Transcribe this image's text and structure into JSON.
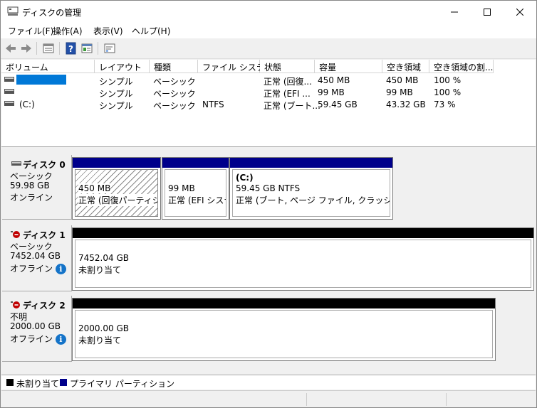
{
  "window": {
    "title": "ディスクの管理",
    "minimize": "—",
    "maximize": "☐",
    "close": "✕"
  },
  "menu": [
    "ファイル(F)",
    "操作(A)",
    "表示(V)",
    "ヘルプ(H)"
  ],
  "toolbar": {
    "icons": [
      "back-arrow-icon",
      "forward-arrow-icon",
      "list-view-icon",
      "help-icon",
      "properties-icon",
      "console-icon"
    ]
  },
  "volume_list": {
    "columns": [
      "ボリューム",
      "レイアウト",
      "種類",
      "ファイル システム",
      "状態",
      "容量",
      "空き領域",
      "空き領域の割..."
    ],
    "rows": [
      {
        "volume": "",
        "layout": "シンプル",
        "type": "ベーシック",
        "fs": "",
        "status": "正常 (回復...",
        "capacity": "450 MB",
        "free": "450 MB",
        "percent": "100 %",
        "selected": true
      },
      {
        "volume": "",
        "layout": "シンプル",
        "type": "ベーシック",
        "fs": "",
        "status": "正常 (EFI ...",
        "capacity": "99 MB",
        "free": "99 MB",
        "percent": "100 %",
        "selected": false
      },
      {
        "volume": "(C:)",
        "layout": "シンプル",
        "type": "ベーシック",
        "fs": "NTFS",
        "status": "正常 (ブート...",
        "capacity": "59.45 GB",
        "free": "43.32 GB",
        "percent": "73 %",
        "selected": false
      }
    ]
  },
  "disks": [
    {
      "name": "ディスク 0",
      "type": "ベーシック",
      "size": "59.98 GB",
      "state": "オンライン",
      "partitions": [
        {
          "title": "",
          "size": "450 MB",
          "status": "正常 (回復パーティション)"
        },
        {
          "title": "",
          "size": "99 MB",
          "status": "正常 (EFI システム パーティション)"
        },
        {
          "title": "(C:)",
          "size": "59.45 GB NTFS",
          "status": "正常 (ブート, ページ ファイル, クラッシュ ダンプ, プライマリ パーティション)"
        }
      ]
    },
    {
      "name": "ディスク 1",
      "type": "ベーシック",
      "size": "7452.04 GB",
      "state": "オフライン",
      "partitions": [
        {
          "size": "7452.04 GB",
          "status": "未割り当て"
        }
      ]
    },
    {
      "name": "ディスク 2",
      "type": "不明",
      "size": "2000.00 GB",
      "state": "オフライン",
      "partitions": [
        {
          "size": "2000.00 GB",
          "status": "未割り当て"
        }
      ]
    }
  ],
  "legend": [
    {
      "label": "未割り当て",
      "color": "#000000"
    },
    {
      "label": "プライマリ パーティション",
      "color": "#00008b"
    }
  ],
  "colors": {
    "primary_bar": "#00008b",
    "unallocated_bar": "#000000",
    "selection": "#0078d7",
    "info": "#1473c8"
  }
}
